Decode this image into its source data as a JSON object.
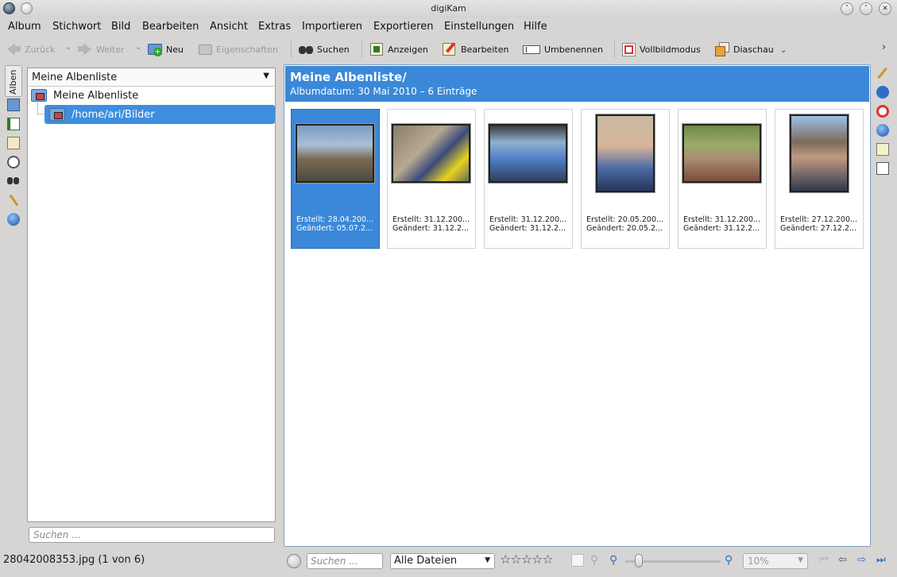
{
  "window": {
    "title": "digiKam"
  },
  "menu": [
    "Album",
    "Stichwort",
    "Bild",
    "Bearbeiten",
    "Ansicht",
    "Extras",
    "Importieren",
    "Exportieren",
    "Einstellungen",
    "Hilfe"
  ],
  "toolbar": {
    "back": "Zurück",
    "forward": "Weiter",
    "new": "Neu",
    "properties": "Eigenschaften",
    "search": "Suchen",
    "view": "Anzeigen",
    "edit": "Bearbeiten",
    "rename": "Umbenennen",
    "fullscreen": "Vollbildmodus",
    "slideshow": "Diaschau"
  },
  "left_tab": {
    "label": "Alben"
  },
  "album_panel": {
    "combo": "Meine Albenliste",
    "root": "Meine Albenliste",
    "child": "/home/ari/Bilder",
    "search_placeholder": "Suchen ..."
  },
  "main": {
    "title": "Meine Albenliste/",
    "subtitle": "Albumdatum: 30 Mai 2010 – 6 Einträge",
    "thumbnails": [
      {
        "created": "Erstellt: 28.04.200...",
        "modified": "Geändert: 05.07.2...",
        "selected": true
      },
      {
        "created": "Erstellt: 31.12.200...",
        "modified": "Geändert: 31.12.2...",
        "selected": false
      },
      {
        "created": "Erstellt: 31.12.200...",
        "modified": "Geändert: 31.12.2...",
        "selected": false
      },
      {
        "created": "Erstellt: 20.05.200...",
        "modified": "Geändert: 20.05.2...",
        "selected": false
      },
      {
        "created": "Erstellt: 31.12.200...",
        "modified": "Geändert: 31.12.2...",
        "selected": false
      },
      {
        "created": "Erstellt: 27.12.200...",
        "modified": "Geändert: 27.12.2...",
        "selected": false
      }
    ]
  },
  "status": {
    "file": "28042008353.jpg (1 von 6)",
    "search_placeholder": "Suchen ...",
    "filter": "Alle Dateien",
    "rating_stars": 0,
    "zoom": "10%"
  },
  "colors": {
    "accent": "#3b88d8",
    "background": "#d6d5d3"
  }
}
